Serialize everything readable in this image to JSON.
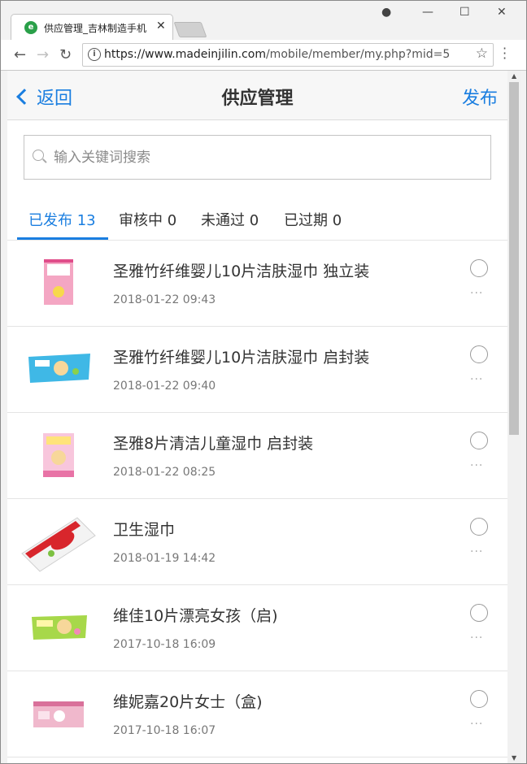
{
  "browser": {
    "tab_title": "供应管理_吉林制造手机",
    "url_host": "https://www.madeinjilin.com",
    "url_path": "/mobile/member/my.php?mid=5"
  },
  "header": {
    "back_label": "返回",
    "title": "供应管理",
    "publish_label": "发布"
  },
  "search": {
    "placeholder": "输入关键词搜索"
  },
  "tabs": [
    {
      "label": "已发布 13",
      "active": true
    },
    {
      "label": "审核中 0",
      "active": false
    },
    {
      "label": "未通过 0",
      "active": false
    },
    {
      "label": "已过期 0",
      "active": false
    }
  ],
  "items": [
    {
      "title": "圣雅竹纤维婴儿10片洁肤湿巾 独立装",
      "date": "2018-01-22 09:43"
    },
    {
      "title": "圣雅竹纤维婴儿10片洁肤湿巾 启封装",
      "date": "2018-01-22 09:40"
    },
    {
      "title": "圣雅8片清洁儿童湿巾 启封装",
      "date": "2018-01-22 08:25"
    },
    {
      "title": "卫生湿巾",
      "date": "2018-01-19 14:42"
    },
    {
      "title": "维佳10片漂亮女孩（启)",
      "date": "2017-10-18 16:09"
    },
    {
      "title": "维妮嘉20片女士（盒)",
      "date": "2017-10-18 16:07"
    }
  ],
  "more_icon": "···",
  "colors": {
    "accent": "#1a7ee0"
  }
}
